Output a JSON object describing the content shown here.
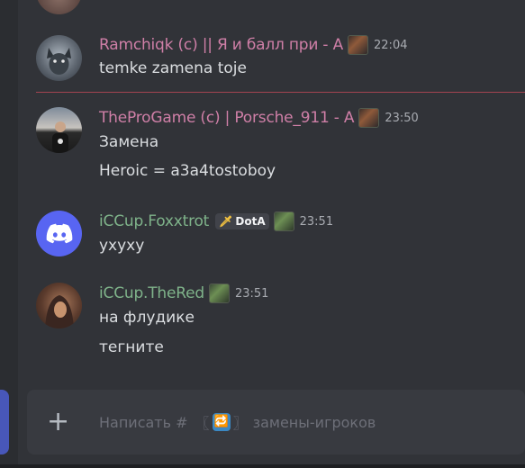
{
  "messages": [
    {
      "username": "Ramchiqk (c) || Я и балл при - А",
      "time": "22:04",
      "lines": [
        "temke zamena toje"
      ]
    },
    {
      "username": "TheProGame (c) | Porsche_911 - А",
      "time": "23:50",
      "lines": [
        "Замена",
        "Heroic = a3a4tostoboy"
      ]
    },
    {
      "username": "iCCup.Foxxtrot",
      "tag": "DotA",
      "time": "23:51",
      "lines": [
        "ухуху"
      ]
    },
    {
      "username": "iCCup.TheRed",
      "time": "23:51",
      "lines": [
        "на флудике",
        "тегните"
      ]
    }
  ],
  "composer": {
    "placeholder_prefix": "Написать #",
    "bracket_open": "〖",
    "channel_emoji": "🔁",
    "bracket_close": "〗",
    "channel_name": "замены-игроков",
    "plus_label": "+"
  },
  "colors": {
    "background": "#313338",
    "username_pink": "#cf7fa7",
    "username_green": "#7fb38a",
    "new_messages_divider": "#cb4a5a",
    "discord_blurple": "#5865f2"
  },
  "icons": [
    "add-attachment-icon",
    "discord-logo-icon",
    "sword-icon",
    "rank-icon"
  ]
}
